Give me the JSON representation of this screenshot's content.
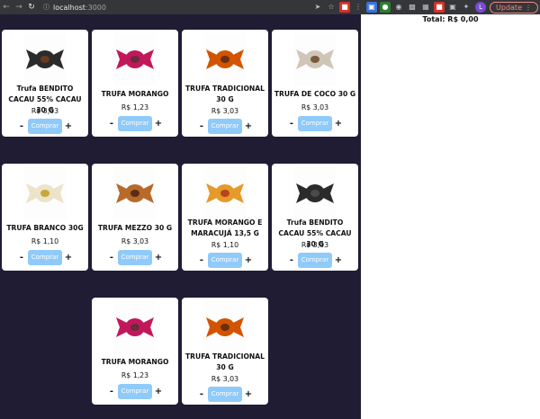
{
  "browser": {
    "url_host": "localhost",
    "url_port": ":3000",
    "update_label": "Update",
    "avatar_letter": "L"
  },
  "cart": {
    "total_text": "Total: R$ 0,00"
  },
  "controls": {
    "minus": "-",
    "plus": "+",
    "buy": "Comprar"
  },
  "products": [
    {
      "name": "Trufa BENDITO CACAU 55% CACAU 30 G",
      "price": "R$ 3,03",
      "wrapper": "#2b2b2b",
      "accent": "#6b3a1e"
    },
    {
      "name": "TRUFA MORANGO",
      "price": "R$ 1,23",
      "wrapper": "#c2185b",
      "accent": "#6b2b3c"
    },
    {
      "name": "TRUFA TRADICIONAL 30 G",
      "price": "R$ 3,03",
      "wrapper": "#d35400",
      "accent": "#6b2f10"
    },
    {
      "name": "TRUFA DE COCO 30 G",
      "price": "R$ 3,03",
      "wrapper": "#cfc6b8",
      "accent": "#7a5a3a"
    },
    {
      "name": "TRUFA BRANCO 30G",
      "price": "R$ 1,10",
      "wrapper": "#ece3c8",
      "accent": "#c9a63a"
    },
    {
      "name": "TRUFA MEZZO 30 G",
      "price": "R$ 3,03",
      "wrapper": "#b86a2a",
      "accent": "#5a2e12"
    },
    {
      "name": "TRUFA MORANGO E MARACUJÁ 13,5 G",
      "price": "R$ 1,10",
      "wrapper": "#e59a2a",
      "accent": "#b5451e"
    },
    {
      "name": "Trufa BENDITO CACAU 55% CACAU 30 G",
      "price": "R$ 3,03",
      "wrapper": "#2b2b2b",
      "accent": "#4a4a4a"
    },
    {
      "name": "TRUFA MORANGO",
      "price": "R$ 1,23",
      "wrapper": "#c2185b",
      "accent": "#6b2b3c"
    },
    {
      "name": "TRUFA TRADICIONAL 30 G",
      "price": "R$ 3,03",
      "wrapper": "#d35400",
      "accent": "#6b2f10"
    }
  ]
}
